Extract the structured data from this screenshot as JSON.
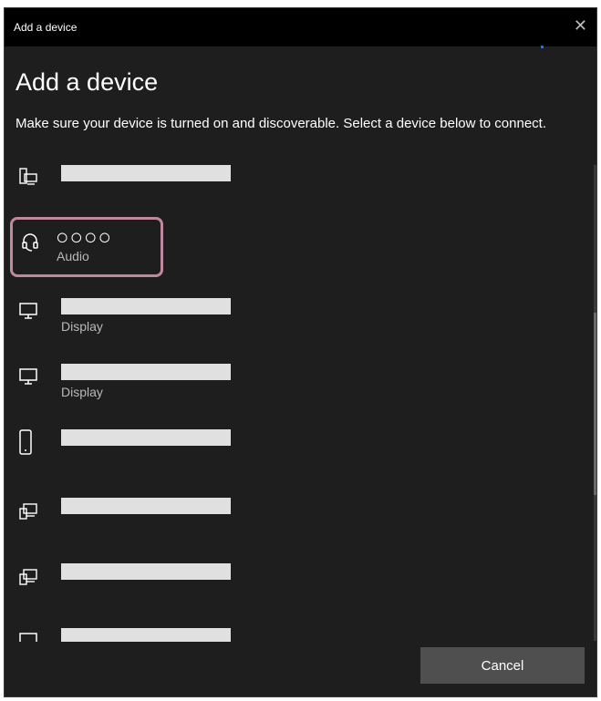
{
  "window": {
    "title": "Add a device",
    "close_glyph": "✕"
  },
  "heading": "Add a device",
  "instruction": "Make sure your device is turned on and discoverable. Select a device below to connect.",
  "devices": [
    {
      "icon": "computer-phone-icon",
      "name": "",
      "type": ""
    },
    {
      "icon": "headset-icon",
      "name": "○○○○",
      "type": "Audio",
      "selected": true
    },
    {
      "icon": "display-icon",
      "name": "",
      "type": "Display"
    },
    {
      "icon": "display-icon",
      "name": "",
      "type": "Display"
    },
    {
      "icon": "phone-icon",
      "name": "",
      "type": ""
    },
    {
      "icon": "devices-icon",
      "name": "",
      "type": ""
    },
    {
      "icon": "devices-icon",
      "name": "",
      "type": ""
    },
    {
      "icon": "monitor-icon",
      "name": "",
      "type": ""
    }
  ],
  "cancel_label": "Cancel",
  "colors": {
    "background": "#1e1e1e",
    "titlebar": "#000000",
    "selection_border": "#c0889e",
    "redacted_bar": "#e0e0e0",
    "button": "#4f4f4f"
  }
}
